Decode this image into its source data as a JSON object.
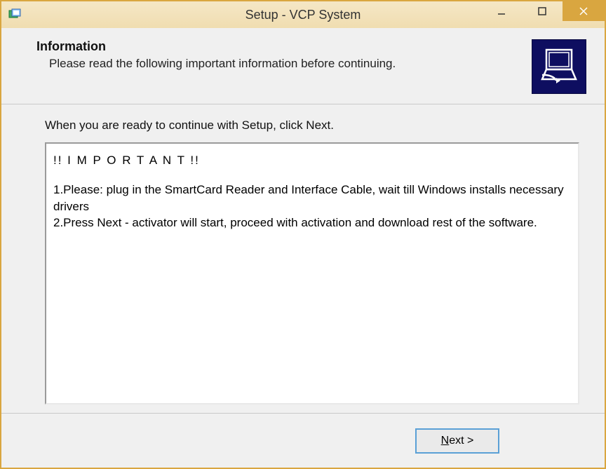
{
  "window": {
    "title": "Setup - VCP System"
  },
  "header": {
    "heading": "Information",
    "subheading": "Please read the following important information before continuing."
  },
  "content": {
    "ready_text": "When you are ready to continue with Setup, click Next.",
    "important_label": "!! I M P O R T A N T !!",
    "step1": "1.Please: plug in the SmartCard Reader and Interface Cable, wait till Windows installs necessary drivers",
    "step2": "2.Press Next - activator will start, proceed with activation and download rest of the software."
  },
  "footer": {
    "next_prefix": "N",
    "next_rest": "ext >"
  }
}
